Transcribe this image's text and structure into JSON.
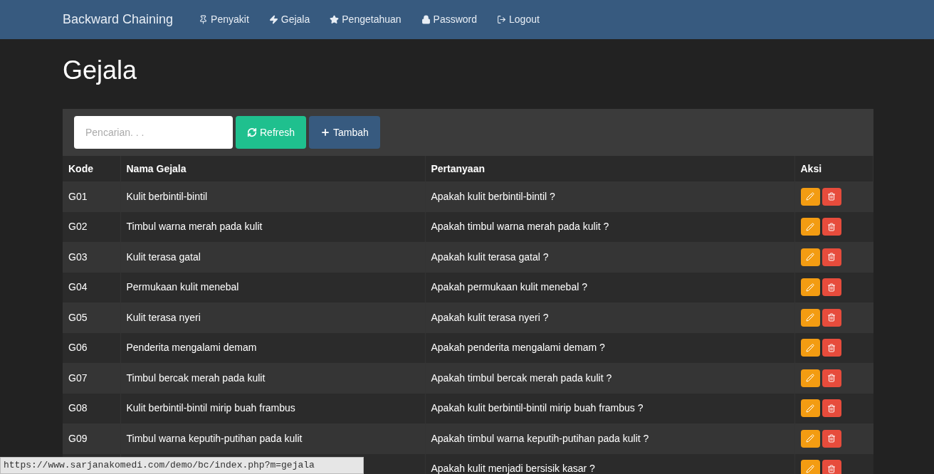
{
  "navbar": {
    "brand": "Backward Chaining",
    "items": [
      {
        "kind": "pin",
        "label": "Penyakit"
      },
      {
        "kind": "bolt",
        "label": "Gejala"
      },
      {
        "kind": "star",
        "label": "Pengetahuan"
      },
      {
        "kind": "lock",
        "label": "Password"
      },
      {
        "kind": "logout",
        "label": "Logout"
      }
    ]
  },
  "page_title": "Gejala",
  "toolbar": {
    "search": {
      "placeholder": "Pencarian. . ."
    },
    "buttons": [
      {
        "kind": "refresh",
        "label": "Refresh"
      },
      {
        "kind": "add",
        "label": "Tambah"
      }
    ]
  },
  "table": {
    "columns": [
      "Kode",
      "Nama Gejala",
      "Pertanyaan",
      "Aksi"
    ],
    "rows": [
      {
        "kode": "G01",
        "nama": "Kulit berbintil-bintil",
        "pertanyaan": "Apakah kulit berbintil-bintil ?"
      },
      {
        "kode": "G02",
        "nama": "Timbul warna merah pada kulit",
        "pertanyaan": "Apakah timbul warna merah pada kulit ?"
      },
      {
        "kode": "G03",
        "nama": "Kulit terasa gatal",
        "pertanyaan": "Apakah kulit terasa gatal ?"
      },
      {
        "kode": "G04",
        "nama": "Permukaan kulit menebal",
        "pertanyaan": "Apakah permukaan kulit menebal ?"
      },
      {
        "kode": "G05",
        "nama": "Kulit terasa nyeri",
        "pertanyaan": "Apakah kulit terasa nyeri ?"
      },
      {
        "kode": "G06",
        "nama": "Penderita mengalami demam",
        "pertanyaan": "Apakah penderita mengalami demam ?"
      },
      {
        "kode": "G07",
        "nama": "Timbul bercak merah pada kulit",
        "pertanyaan": "Apakah timbul bercak merah pada kulit ?"
      },
      {
        "kode": "G08",
        "nama": "Kulit berbintil-bintil mirip buah frambus",
        "pertanyaan": "Apakah kulit berbintil-bintil mirip buah frambus ?"
      },
      {
        "kode": "G09",
        "nama": "Timbul warna keputih-putihan pada kulit",
        "pertanyaan": "Apakah timbul warna keputih-putihan pada kulit ?"
      },
      {
        "pertanyaan": "Apakah kulit menjadi bersisik kasar ?"
      }
    ]
  },
  "status_url": "https://www.sarjanakomedi.com/demo/bc/index.php?m=gejala"
}
